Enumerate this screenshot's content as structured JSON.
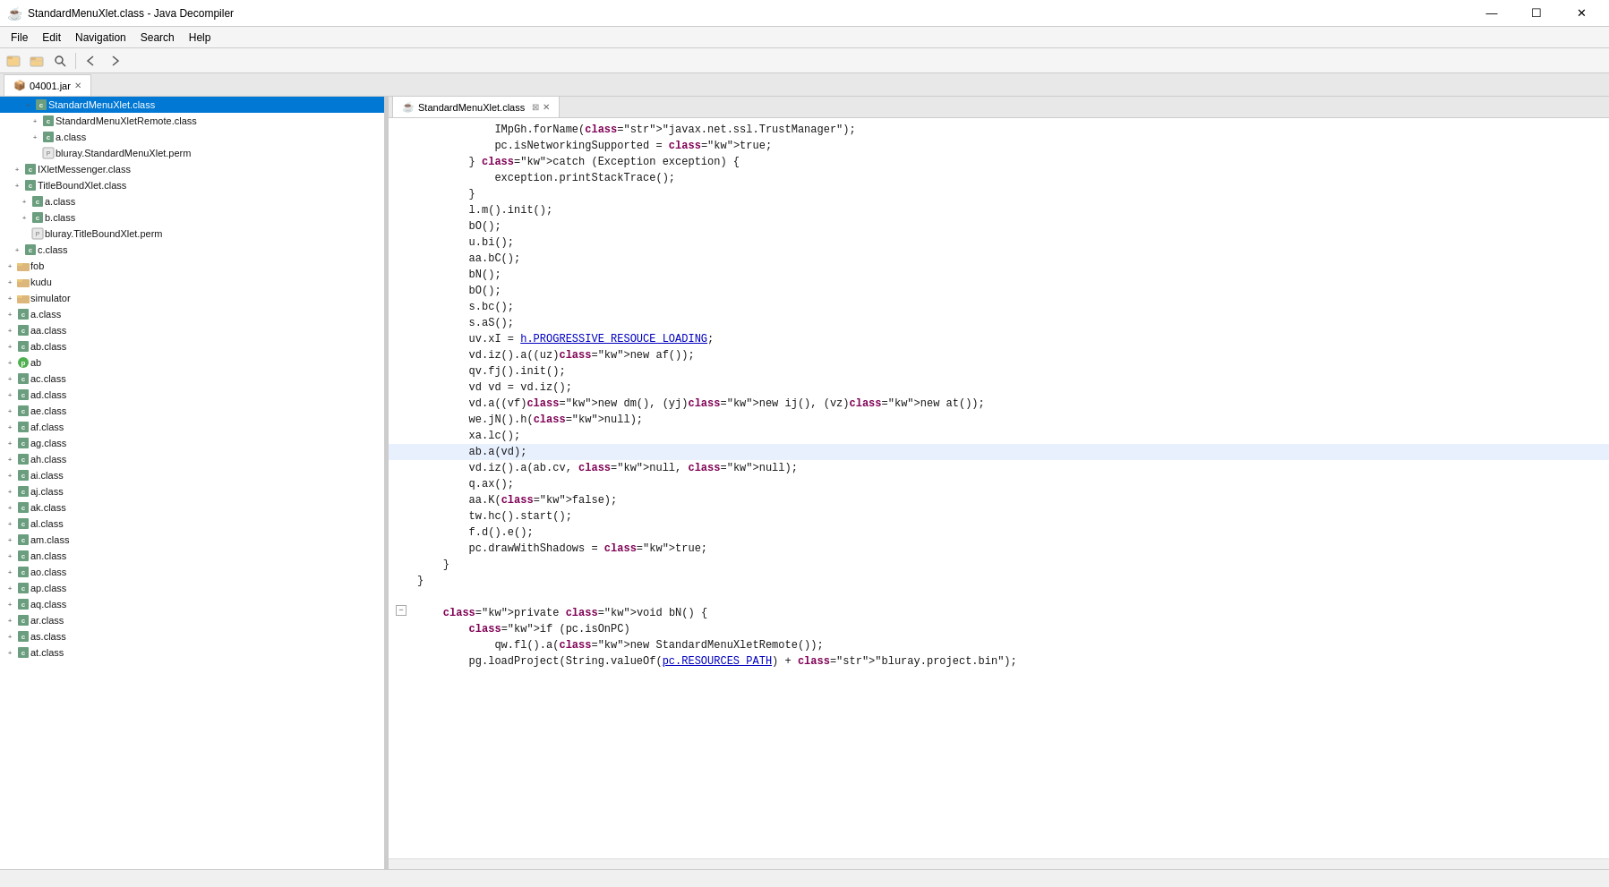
{
  "titleBar": {
    "icon": "☕",
    "title": "StandardMenuXlet.class - Java Decompiler",
    "minimize": "—",
    "maximize": "☐",
    "close": "✕"
  },
  "menuBar": {
    "items": [
      "File",
      "Edit",
      "Navigation",
      "Search",
      "Help"
    ]
  },
  "toolbar": {
    "buttons": [
      {
        "name": "open-file",
        "icon": "📂"
      },
      {
        "name": "open-folder",
        "icon": "📁"
      },
      {
        "name": "search",
        "icon": "🔍"
      },
      {
        "name": "back",
        "icon": "←"
      },
      {
        "name": "forward",
        "icon": "→"
      }
    ]
  },
  "tabBar": {
    "tabs": [
      {
        "name": "04001.jar",
        "icon": "📦",
        "active": true
      }
    ]
  },
  "codeTab": {
    "label": "StandardMenuXlet.class",
    "icon": "☕",
    "closeIcon": "✕"
  },
  "fileTree": {
    "items": [
      {
        "indent": 20,
        "expand": "+",
        "icon": "class",
        "label": "StandardMenuXlet.class",
        "selected": true
      },
      {
        "indent": 28,
        "expand": "+",
        "icon": "class",
        "label": "StandardMenuXletRemote.class",
        "selected": false
      },
      {
        "indent": 28,
        "expand": "+",
        "icon": "class",
        "label": "a.class",
        "selected": false
      },
      {
        "indent": 28,
        "expand": "",
        "icon": "perm",
        "label": "bluray.StandardMenuXlet.perm",
        "selected": false
      },
      {
        "indent": 8,
        "expand": "+",
        "icon": "class",
        "label": "IXletMessenger.class",
        "selected": false
      },
      {
        "indent": 8,
        "expand": "+",
        "icon": "class",
        "label": "TitleBoundXlet.class",
        "selected": false
      },
      {
        "indent": 16,
        "expand": "+",
        "icon": "class",
        "label": "a.class",
        "selected": false
      },
      {
        "indent": 16,
        "expand": "+",
        "icon": "class",
        "label": "b.class",
        "selected": false
      },
      {
        "indent": 16,
        "expand": "",
        "icon": "perm",
        "label": "bluray.TitleBoundXlet.perm",
        "selected": false
      },
      {
        "indent": 8,
        "expand": "+",
        "icon": "class",
        "label": "c.class",
        "selected": false
      },
      {
        "indent": 0,
        "expand": "+",
        "icon": "folder",
        "label": "fob",
        "selected": false
      },
      {
        "indent": 0,
        "expand": "+",
        "icon": "folder",
        "label": "kudu",
        "selected": false
      },
      {
        "indent": 0,
        "expand": "+",
        "icon": "folder",
        "label": "simulator",
        "selected": false
      },
      {
        "indent": 0,
        "expand": "+",
        "icon": "class",
        "label": "a.class",
        "selected": false
      },
      {
        "indent": 0,
        "expand": "+",
        "icon": "class",
        "label": "aa.class",
        "selected": false
      },
      {
        "indent": 0,
        "expand": "+",
        "icon": "class",
        "label": "ab.class",
        "selected": false
      },
      {
        "indent": 0,
        "expand": "+",
        "icon": "pkg",
        "label": "ab",
        "selected": false
      },
      {
        "indent": 0,
        "expand": "+",
        "icon": "class",
        "label": "ac.class",
        "selected": false
      },
      {
        "indent": 0,
        "expand": "+",
        "icon": "class",
        "label": "ad.class",
        "selected": false
      },
      {
        "indent": 0,
        "expand": "+",
        "icon": "class",
        "label": "ae.class",
        "selected": false
      },
      {
        "indent": 0,
        "expand": "+",
        "icon": "class",
        "label": "af.class",
        "selected": false
      },
      {
        "indent": 0,
        "expand": "+",
        "icon": "class",
        "label": "ag.class",
        "selected": false
      },
      {
        "indent": 0,
        "expand": "+",
        "icon": "class",
        "label": "ah.class",
        "selected": false
      },
      {
        "indent": 0,
        "expand": "+",
        "icon": "class",
        "label": "ai.class",
        "selected": false
      },
      {
        "indent": 0,
        "expand": "+",
        "icon": "class",
        "label": "aj.class",
        "selected": false
      },
      {
        "indent": 0,
        "expand": "+",
        "icon": "class",
        "label": "ak.class",
        "selected": false
      },
      {
        "indent": 0,
        "expand": "+",
        "icon": "class",
        "label": "al.class",
        "selected": false
      },
      {
        "indent": 0,
        "expand": "+",
        "icon": "class",
        "label": "am.class",
        "selected": false
      },
      {
        "indent": 0,
        "expand": "+",
        "icon": "class",
        "label": "an.class",
        "selected": false
      },
      {
        "indent": 0,
        "expand": "+",
        "icon": "class",
        "label": "ao.class",
        "selected": false
      },
      {
        "indent": 0,
        "expand": "+",
        "icon": "class",
        "label": "ap.class",
        "selected": false
      },
      {
        "indent": 0,
        "expand": "+",
        "icon": "class",
        "label": "aq.class",
        "selected": false
      },
      {
        "indent": 0,
        "expand": "+",
        "icon": "class",
        "label": "ar.class",
        "selected": false
      },
      {
        "indent": 0,
        "expand": "+",
        "icon": "class",
        "label": "as.class",
        "selected": false
      },
      {
        "indent": 0,
        "expand": "+",
        "icon": "class",
        "label": "at.class",
        "selected": false
      }
    ]
  },
  "codeLines": [
    {
      "id": 1,
      "collapse": false,
      "text": "            IMpGh.forName(\"javax.net.ssl.TrustManager\");",
      "highlighted": false
    },
    {
      "id": 2,
      "collapse": false,
      "text": "            pc.isNetworkingSupported = true;",
      "highlighted": false
    },
    {
      "id": 3,
      "collapse": false,
      "text": "        } catch (Exception exception) {",
      "highlighted": false
    },
    {
      "id": 4,
      "collapse": false,
      "text": "            exception.printStackTrace();",
      "highlighted": false
    },
    {
      "id": 5,
      "collapse": false,
      "text": "        }",
      "highlighted": false
    },
    {
      "id": 6,
      "collapse": false,
      "text": "        l.m().init();",
      "highlighted": false
    },
    {
      "id": 7,
      "collapse": false,
      "text": "        bO();",
      "highlighted": false
    },
    {
      "id": 8,
      "collapse": false,
      "text": "        u.bi();",
      "highlighted": false
    },
    {
      "id": 9,
      "collapse": false,
      "text": "        aa.bC();",
      "highlighted": false
    },
    {
      "id": 10,
      "collapse": false,
      "text": "        bN();",
      "highlighted": false
    },
    {
      "id": 11,
      "collapse": false,
      "text": "        bO();",
      "highlighted": false
    },
    {
      "id": 12,
      "collapse": false,
      "text": "        s.bc();",
      "highlighted": false
    },
    {
      "id": 13,
      "collapse": false,
      "text": "        s.aS();",
      "highlighted": false
    },
    {
      "id": 14,
      "collapse": false,
      "text": "        uv.xI = h.PROGRESSIVE_RESOUCE_LOADING;",
      "highlighted": false
    },
    {
      "id": 15,
      "collapse": false,
      "text": "        vd.iz().a((uz)new af());",
      "highlighted": false
    },
    {
      "id": 16,
      "collapse": false,
      "text": "        qv.fj().init();",
      "highlighted": false
    },
    {
      "id": 17,
      "collapse": false,
      "text": "        vd vd = vd.iz();",
      "highlighted": false
    },
    {
      "id": 18,
      "collapse": false,
      "text": "        vd.a((vf)new dm(), (yj)new ij(), (vz)new at());",
      "highlighted": false
    },
    {
      "id": 19,
      "collapse": false,
      "text": "        we.jN().h(null);",
      "highlighted": false
    },
    {
      "id": 20,
      "collapse": false,
      "text": "        xa.lc();",
      "highlighted": false
    },
    {
      "id": 21,
      "collapse": false,
      "text": "        ab.a(vd);",
      "highlighted": true
    },
    {
      "id": 22,
      "collapse": false,
      "text": "        vd.iz().a(ab.cv, null, null);",
      "highlighted": false
    },
    {
      "id": 23,
      "collapse": false,
      "text": "        q.ax();",
      "highlighted": false
    },
    {
      "id": 24,
      "collapse": false,
      "text": "        aa.K(false);",
      "highlighted": false
    },
    {
      "id": 25,
      "collapse": false,
      "text": "        tw.hc().start();",
      "highlighted": false
    },
    {
      "id": 26,
      "collapse": false,
      "text": "        f.d().e();",
      "highlighted": false
    },
    {
      "id": 27,
      "collapse": false,
      "text": "        pc.drawWithShadows = true;",
      "highlighted": false
    },
    {
      "id": 28,
      "collapse": false,
      "text": "    }",
      "highlighted": false
    },
    {
      "id": 29,
      "collapse": false,
      "text": "}",
      "highlighted": false
    },
    {
      "id": 30,
      "collapse": false,
      "text": "",
      "highlighted": false
    },
    {
      "id": 31,
      "collapse": true,
      "text": "    private void bN() {",
      "highlighted": false
    },
    {
      "id": 32,
      "collapse": false,
      "text": "        if (pc.isOnPC)",
      "highlighted": false
    },
    {
      "id": 33,
      "collapse": false,
      "text": "            qw.fl().a(new StandardMenuXletRemote());",
      "highlighted": false
    },
    {
      "id": 34,
      "collapse": false,
      "text": "        pg.loadProject(String.valueOf(pc.RESOURCES_PATH) + \"bluray.project.bin\");",
      "highlighted": false
    }
  ],
  "statusBar": {
    "text": ""
  }
}
